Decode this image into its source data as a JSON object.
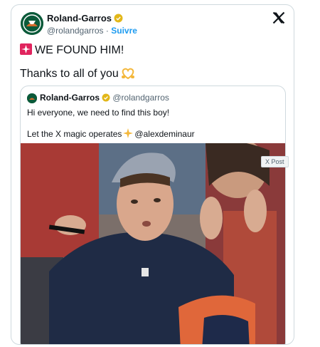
{
  "author": {
    "name": "Roland-Garros",
    "handle": "@rolandgarros",
    "separator": "·",
    "follow_label": "Suivre"
  },
  "tweet": {
    "line1": "WE FOUND HIM!",
    "line2": "Thanks to all of you"
  },
  "quote": {
    "name": "Roland-Garros",
    "handle": "@rolandgarros",
    "line1": "Hi everyone, we need to find this boy!",
    "line2_prefix": "Let the X magic operates",
    "mention": "@alexdeminaur"
  },
  "badge": {
    "label": "X Post"
  },
  "icons": {
    "siren": "siren-icon",
    "heart_hands": "heart-hands-icon",
    "sparkles": "sparkles-icon",
    "verified": "verified-badge-icon",
    "x_logo": "x-logo-icon"
  },
  "colors": {
    "link": "#1d9bf0",
    "verified_gold": "#e2b719",
    "brand_green": "#0b5a3a",
    "clay": "#d46a2c"
  }
}
